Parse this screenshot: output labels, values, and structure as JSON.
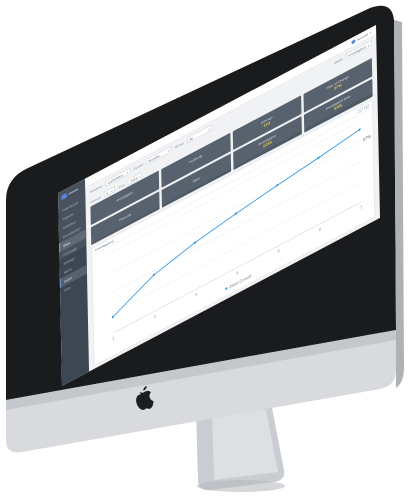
{
  "sidebar": {
    "items": [
      {
        "label": "Dashboard",
        "active": false
      },
      {
        "label": "Reports",
        "active": false
      },
      {
        "label": "Analytics",
        "active": false
      },
      {
        "label": "Investigation",
        "active": false
      },
      {
        "label": "Sites",
        "active": true
      },
      {
        "label": "Coverage",
        "active": false
      },
      {
        "label": "Settings",
        "active": false
      },
      {
        "label": "Alerts",
        "active": false
      },
      {
        "label": "Users",
        "active": true
      },
      {
        "label": "Help",
        "active": false
      }
    ]
  },
  "topbar": {
    "user_label": "Account"
  },
  "filters": {
    "label_a": "Analysis",
    "select_a": "Cumulative",
    "label_b": "Period",
    "select_b": "Monthly",
    "label_c": "Group",
    "select_c": "All"
  },
  "filters_row2": {
    "label_a": "Interval",
    "select_a": "3",
    "label_b": "Year",
    "select_b": "2016",
    "label_right": "Metric",
    "select_right": "Investigated"
  },
  "tiles": [
    {
      "label": "Investigator",
      "value": ""
    },
    {
      "label": "Incidents",
      "value": ""
    },
    {
      "label": "Average",
      "value": "123"
    },
    {
      "label": "Rate of Change",
      "value": "37%"
    },
    {
      "label": "Records",
      "value": ""
    },
    {
      "label": "Sites",
      "value": ""
    },
    {
      "label": "Investigated",
      "value": "1234"
    },
    {
      "label": "Investigated Rate",
      "value": "54%"
    }
  ],
  "chart": {
    "title": "Investigators",
    "tool_a": "≡",
    "tool_b": "⇅"
  },
  "chart_data": {
    "type": "line",
    "x": [
      1,
      2,
      3,
      4,
      5,
      6,
      7
    ],
    "series": [
      {
        "name": "2016 Cohort",
        "values": [
          20,
          45,
          58,
          67,
          75,
          82,
          90
        ]
      }
    ],
    "xlabel": "",
    "ylabel": "",
    "ylim": [
      0,
      100
    ],
    "grid": true,
    "legend": "bottom",
    "line_color": "#2f95e0",
    "right_label": "57%"
  },
  "colors": {
    "sidebar_bg": "#3d4754",
    "tile_bg": "#4e5966",
    "tile_value": "#f2d23f",
    "accent": "#2f95e0"
  },
  "icons": {
    "brand": "apple-logo-icon",
    "user": "user-avatar-icon"
  }
}
